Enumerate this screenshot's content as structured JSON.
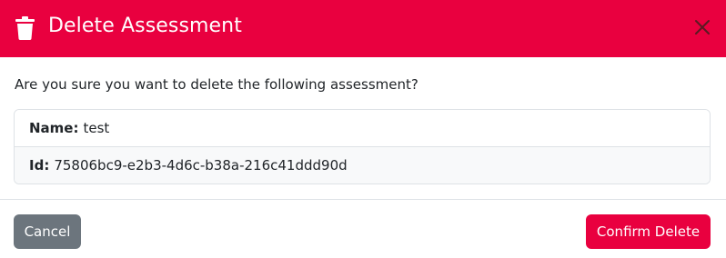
{
  "header": {
    "title": "Delete Assessment",
    "icon": "trash-icon",
    "close_icon": "close-icon",
    "background_color": "#e9003f"
  },
  "body": {
    "prompt": "Are you sure you want to delete the following assessment?",
    "details": [
      {
        "label": "Name:",
        "value": "test"
      },
      {
        "label": "Id:",
        "value": "75806bc9-e2b3-4d6c-b38a-216c41ddd90d"
      }
    ]
  },
  "footer": {
    "cancel_label": "Cancel",
    "confirm_label": "Confirm Delete",
    "cancel_color": "#6c757d",
    "confirm_color": "#e9003f"
  }
}
